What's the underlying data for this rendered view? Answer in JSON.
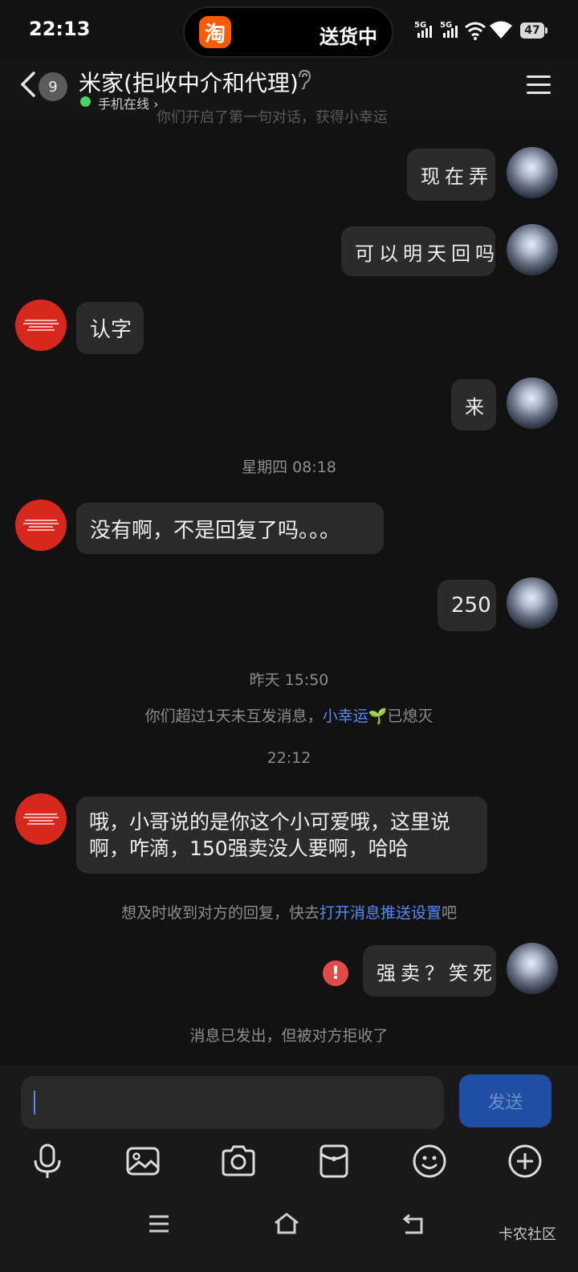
{
  "status_bar": {
    "time": "22:13",
    "pill_app_icon": "淘",
    "pill_text": "送货中",
    "signal1": "5G",
    "signal2": "5G",
    "battery": "47"
  },
  "header": {
    "unread_count": "9",
    "title": "米家(拒收中介和代理)",
    "presence": "手机在线"
  },
  "cut_off_text": "你们开启了第一句对话，获得小幸运",
  "messages": [
    {
      "side": "right",
      "text": "现在弄"
    },
    {
      "side": "right",
      "text": "可以明天回吗"
    },
    {
      "side": "left",
      "text": "认字"
    },
    {
      "side": "right",
      "text": "来"
    },
    {
      "type": "time",
      "text": "星期四 08:18"
    },
    {
      "side": "left",
      "text": "没有啊，不是回复了吗。。。"
    },
    {
      "side": "right",
      "text": "250"
    },
    {
      "type": "time",
      "text": "昨天 15:50"
    },
    {
      "type": "system",
      "before": "你们超过1天未互发消息，",
      "link": "小幸运",
      "after": "已熄灭"
    },
    {
      "type": "time",
      "text": "22:12"
    },
    {
      "side": "left",
      "text": "哦，小哥说的是你这个小可爱哦，这里说啊，咋滴，150强卖没人要啊，哈哈"
    },
    {
      "type": "system",
      "before": "想及时收到对方的回复，快去",
      "link": "打开消息推送设置",
      "after": "吧"
    },
    {
      "side": "right",
      "text": "强卖？笑死",
      "status": "failed"
    },
    {
      "type": "system",
      "text": "消息已发出，但被对方拒收了"
    }
  ],
  "input": {
    "value": "",
    "send_label": "发送"
  },
  "toolbar": [
    "mic-icon",
    "image-icon",
    "camera-icon",
    "red-packet-icon",
    "emoji-icon",
    "plus-icon"
  ],
  "watermark": "卡农社区"
}
